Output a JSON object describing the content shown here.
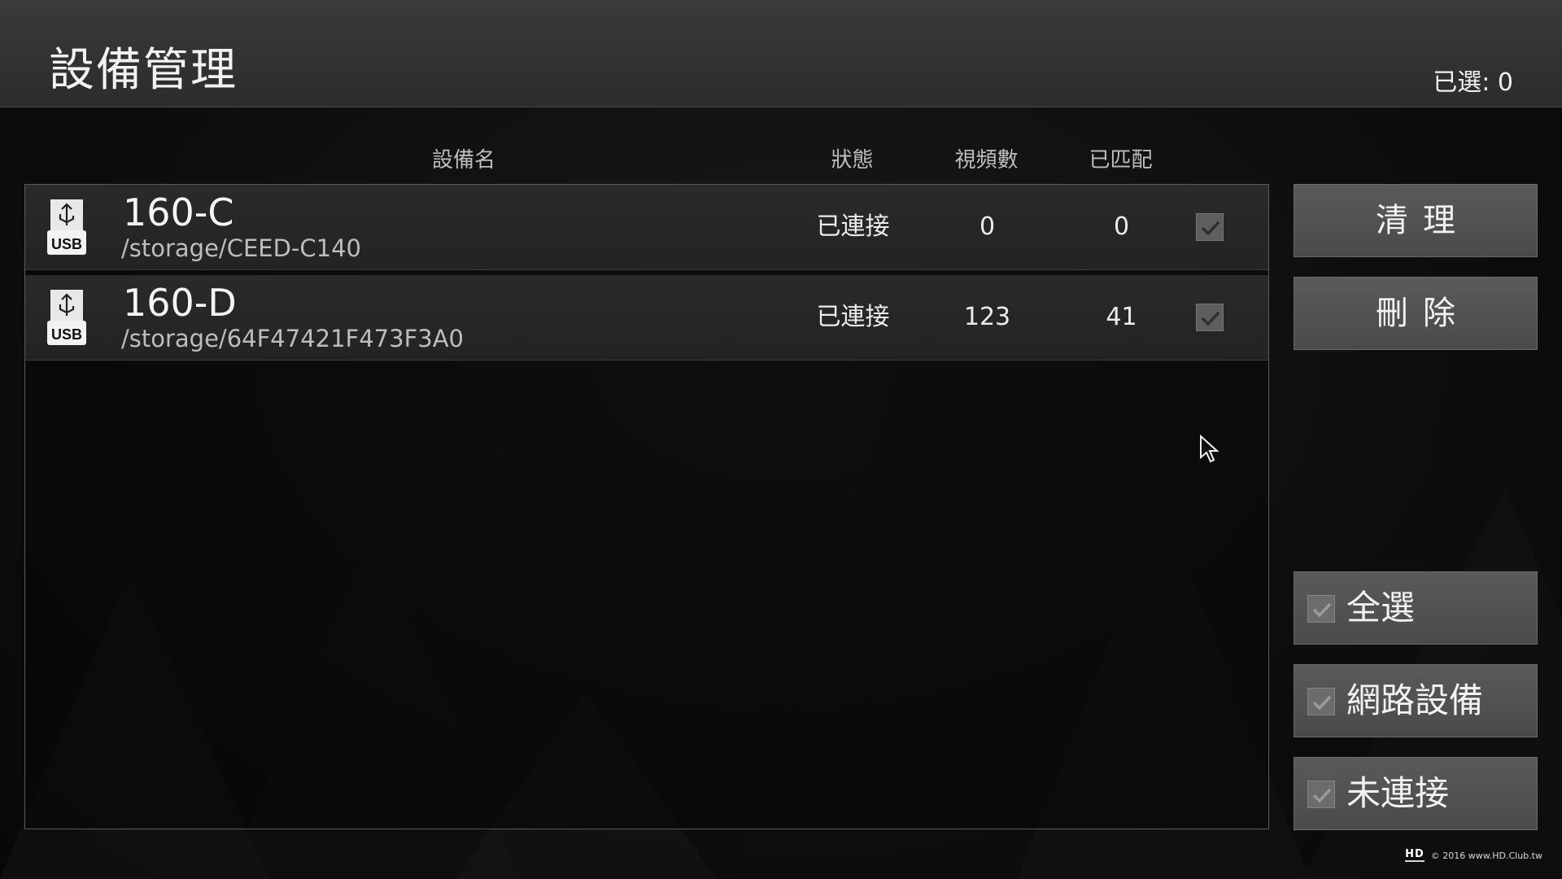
{
  "header": {
    "title": "設備管理",
    "selected_label": "已選: 0"
  },
  "columns": {
    "name": "設備名",
    "status": "狀態",
    "videos": "視頻數",
    "matched": "已匹配"
  },
  "devices": [
    {
      "icon": "usb-icon",
      "icon_label": "USB",
      "name": "160-C",
      "path": "/storage/CEED-C140",
      "status": "已連接",
      "videos": "0",
      "matched": "0",
      "checked": true
    },
    {
      "icon": "usb-icon",
      "icon_label": "USB",
      "name": "160-D",
      "path": "/storage/64F47421F473F3A0",
      "status": "已連接",
      "videos": "123",
      "matched": "41",
      "checked": true
    }
  ],
  "actions": {
    "clean_label": "清理",
    "delete_label": "刪除"
  },
  "filters": {
    "select_all_label": "全選",
    "network_devices_label": "網路設備",
    "not_connected_label": "未連接"
  },
  "watermark": {
    "logo": "HD",
    "text": "© 2016  www.HD.Club.tw"
  },
  "colors": {
    "header_bg": "#333333",
    "panel_row_bg": "#262626",
    "button_bg": "#525252",
    "checkbox_bg": "#6c6c6c"
  }
}
